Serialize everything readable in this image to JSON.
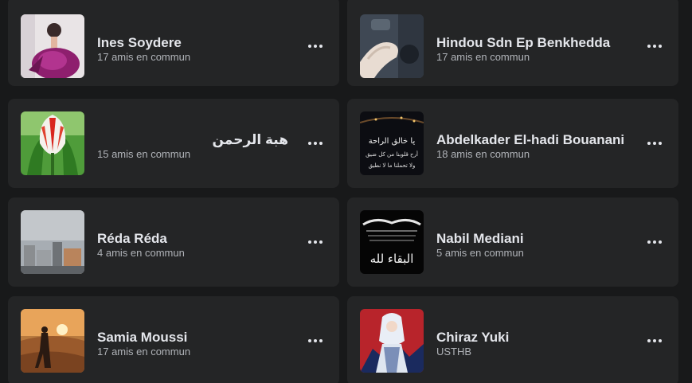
{
  "friends": [
    {
      "name": "Ines Soydere",
      "subtitle": "17 amis en commun",
      "avatar_icon": "profile-photo-woman-purple-dress"
    },
    {
      "name": "Hindou Sdn Ep Benkhedda",
      "subtitle": "17 amis en commun",
      "avatar_icon": "profile-photo-hands"
    },
    {
      "name": "هبة الرحمن",
      "subtitle": "15 amis en commun",
      "avatar_icon": "profile-photo-tulip"
    },
    {
      "name": "Abdelkader El-hadi Bouanani",
      "subtitle": "18 amis en commun",
      "avatar_icon": "profile-photo-arabic-text-night",
      "avatar_text": [
        "يا خالق الراحة",
        "أرح قلوبنا من كل ضيق",
        "ولا تحملنا ما لا نطيق"
      ]
    },
    {
      "name": "Réda Réda",
      "subtitle": "4 amis en commun",
      "avatar_icon": "profile-photo-city"
    },
    {
      "name": "Nabil Mediani",
      "subtitle": "5 amis en commun",
      "avatar_icon": "profile-photo-arabic-calligraphy",
      "avatar_text": [
        "البقاء لله"
      ]
    },
    {
      "name": "Samia Moussi",
      "subtitle": "17 amis en commun",
      "avatar_icon": "profile-photo-desert-sunset"
    },
    {
      "name": "Chiraz Yuki",
      "subtitle": "USTHB",
      "avatar_icon": "profile-photo-anime-character"
    }
  ],
  "more_button_icon": "more-horizontal-icon"
}
